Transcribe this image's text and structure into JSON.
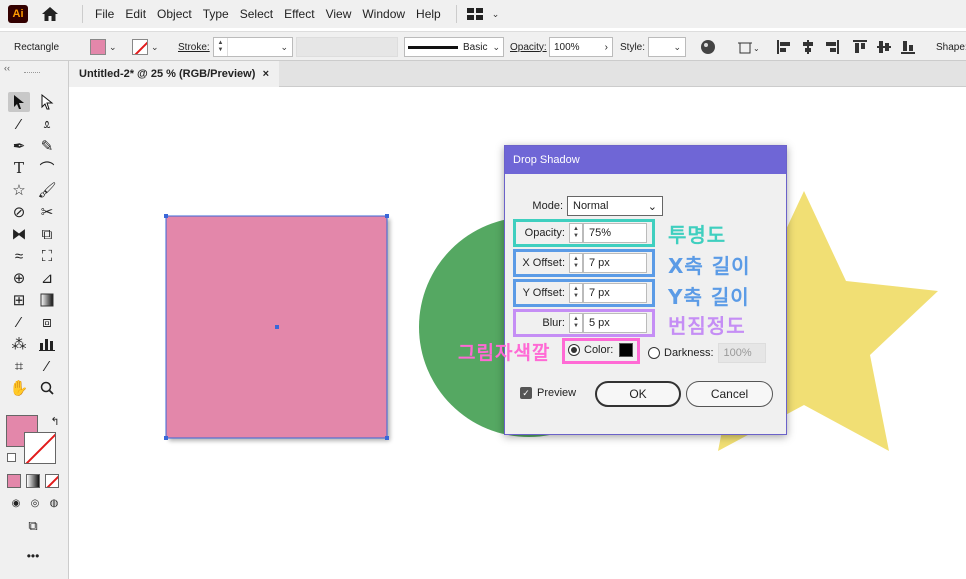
{
  "app": {
    "logo": "Ai"
  },
  "menu": [
    "File",
    "Edit",
    "Object",
    "Type",
    "Select",
    "Effect",
    "View",
    "Window",
    "Help"
  ],
  "control_bar": {
    "selection_type": "Rectangle",
    "stroke_label": "Stroke:",
    "stroke_style": "Basic",
    "opacity_label": "Opacity:",
    "opacity_value": "100%",
    "style_label": "Style:",
    "shape_label": "Shape:",
    "fill_color": "#e387aa"
  },
  "document": {
    "tab_title": "Untitled-2* @ 25 % (RGB/Preview)",
    "close": "×"
  },
  "toolbar": {
    "collapse": "‹‹",
    "more": "•••",
    "tools": [
      "selection-tool",
      "direct-selection-tool",
      "magic-wand-tool",
      "lasso-tool",
      "pen-tool",
      "curvature-tool",
      "type-tool",
      "arc-tool",
      "shape-tool",
      "paintbrush-tool",
      "shaper-tool",
      "scissors-tool",
      "rotate-tool",
      "scale-tool",
      "width-tool",
      "free-transform-tool",
      "shape-builder-tool",
      "perspective-grid-tool",
      "mesh-tool",
      "gradient-tool",
      "eyedropper-tool",
      "blend-tool",
      "symbol-sprayer-tool",
      "column-graph-tool",
      "artboard-tool",
      "slice-tool",
      "hand-tool",
      "zoom-tool"
    ]
  },
  "canvas": {
    "square_color": "#e387aa",
    "circle_color": "#55a862",
    "star_color": "#f1df74"
  },
  "dialog": {
    "title": "Drop Shadow",
    "mode_label": "Mode:",
    "mode_value": "Normal",
    "opacity_label": "Opacity:",
    "opacity_value": "75%",
    "x_offset_label": "X Offset:",
    "x_offset_value": "7 px",
    "y_offset_label": "Y Offset:",
    "y_offset_value": "7 px",
    "blur_label": "Blur:",
    "blur_value": "5 px",
    "color_label": "Color:",
    "darkness_label": "Darkness:",
    "darkness_value": "100%",
    "preview_label": "Preview",
    "ok_label": "OK",
    "cancel_label": "Cancel"
  },
  "annotations": {
    "opacity_note": "투명도",
    "x_note": "X축 길이",
    "y_note": "Y축 길이",
    "blur_note": "번짐정도",
    "color_note": "그림자색깔",
    "colors": {
      "teal": "#3fcfbf",
      "blue": "#5b9be6",
      "purple": "#c58ef5",
      "pink": "#ff6ad5"
    }
  }
}
